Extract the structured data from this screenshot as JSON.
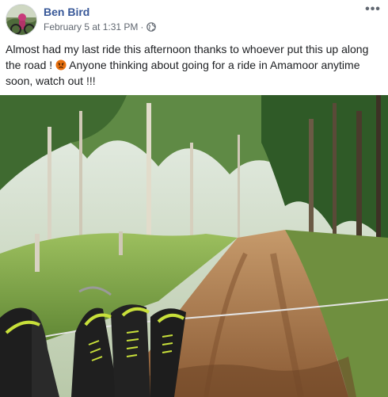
{
  "post": {
    "author": "Ben Bird",
    "timestamp": "February 5 at 1:31 PM",
    "separator": "·",
    "audience_icon": "globe-icon",
    "more_icon": "more-options-icon",
    "more_label": "•••",
    "text_before_emoji": "Almost had my last ride this afternoon thanks to whoever put this up along the road ! ",
    "emoji": "angry-face-emoji",
    "text_after_emoji": " Anyone thinking about going for a ride in Amamoor anytime soon, watch out !!!"
  },
  "colors": {
    "author_link": "#385898",
    "meta_text": "#606770",
    "body_text": "#1c1e21",
    "emoji_fill": "#e9710f"
  }
}
